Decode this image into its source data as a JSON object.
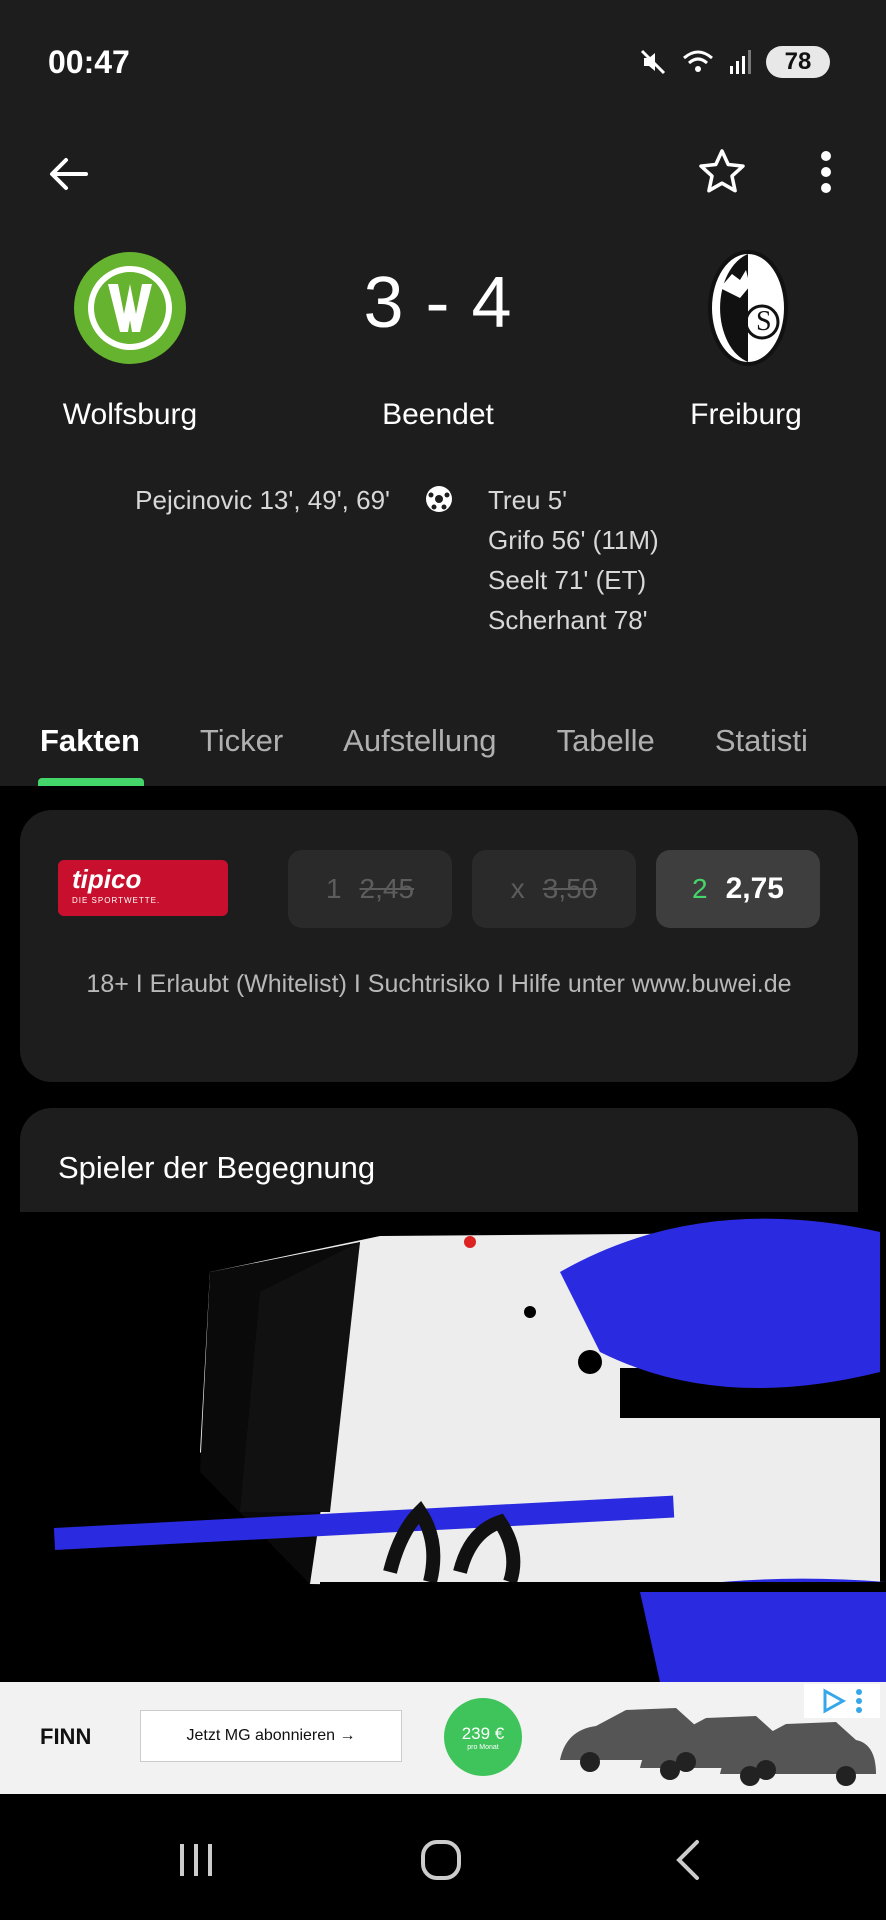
{
  "status_bar": {
    "time": "00:47",
    "battery": "78"
  },
  "header": {
    "home_team": "Wolfsburg",
    "away_team": "Freiburg",
    "score": "3 - 4",
    "status": "Beendet",
    "home_scorers": [
      "Pejcinovic 13', 49', 69'"
    ],
    "away_scorers": [
      "Treu 5'",
      "Grifo 56' (11M)",
      "Seelt 71' (ET)",
      "Scherhant 78'"
    ]
  },
  "tabs": [
    "Fakten",
    "Ticker",
    "Aufstellung",
    "Tabelle",
    "Statisti"
  ],
  "odds": {
    "bookmaker": "tipico",
    "bookmaker_sub": "DIE SPORTWETTE.",
    "items": [
      {
        "label": "1",
        "value": "2,45"
      },
      {
        "label": "x",
        "value": "3,50"
      },
      {
        "label": "2",
        "value": "2,75"
      }
    ],
    "disclaimer": "18+ I Erlaubt (Whitelist) I Suchtrisiko I Hilfe unter www.buwei.de"
  },
  "player_section": {
    "title": "Spieler der Begegnung"
  },
  "ad": {
    "brand": "FINN",
    "cta": "Jetzt MG abonnieren →",
    "price": "239 €",
    "price_sub": "pro Monat"
  },
  "colors": {
    "accent": "#45d66b",
    "surface": "#1d1d1d",
    "tipico": "#c8102e"
  }
}
